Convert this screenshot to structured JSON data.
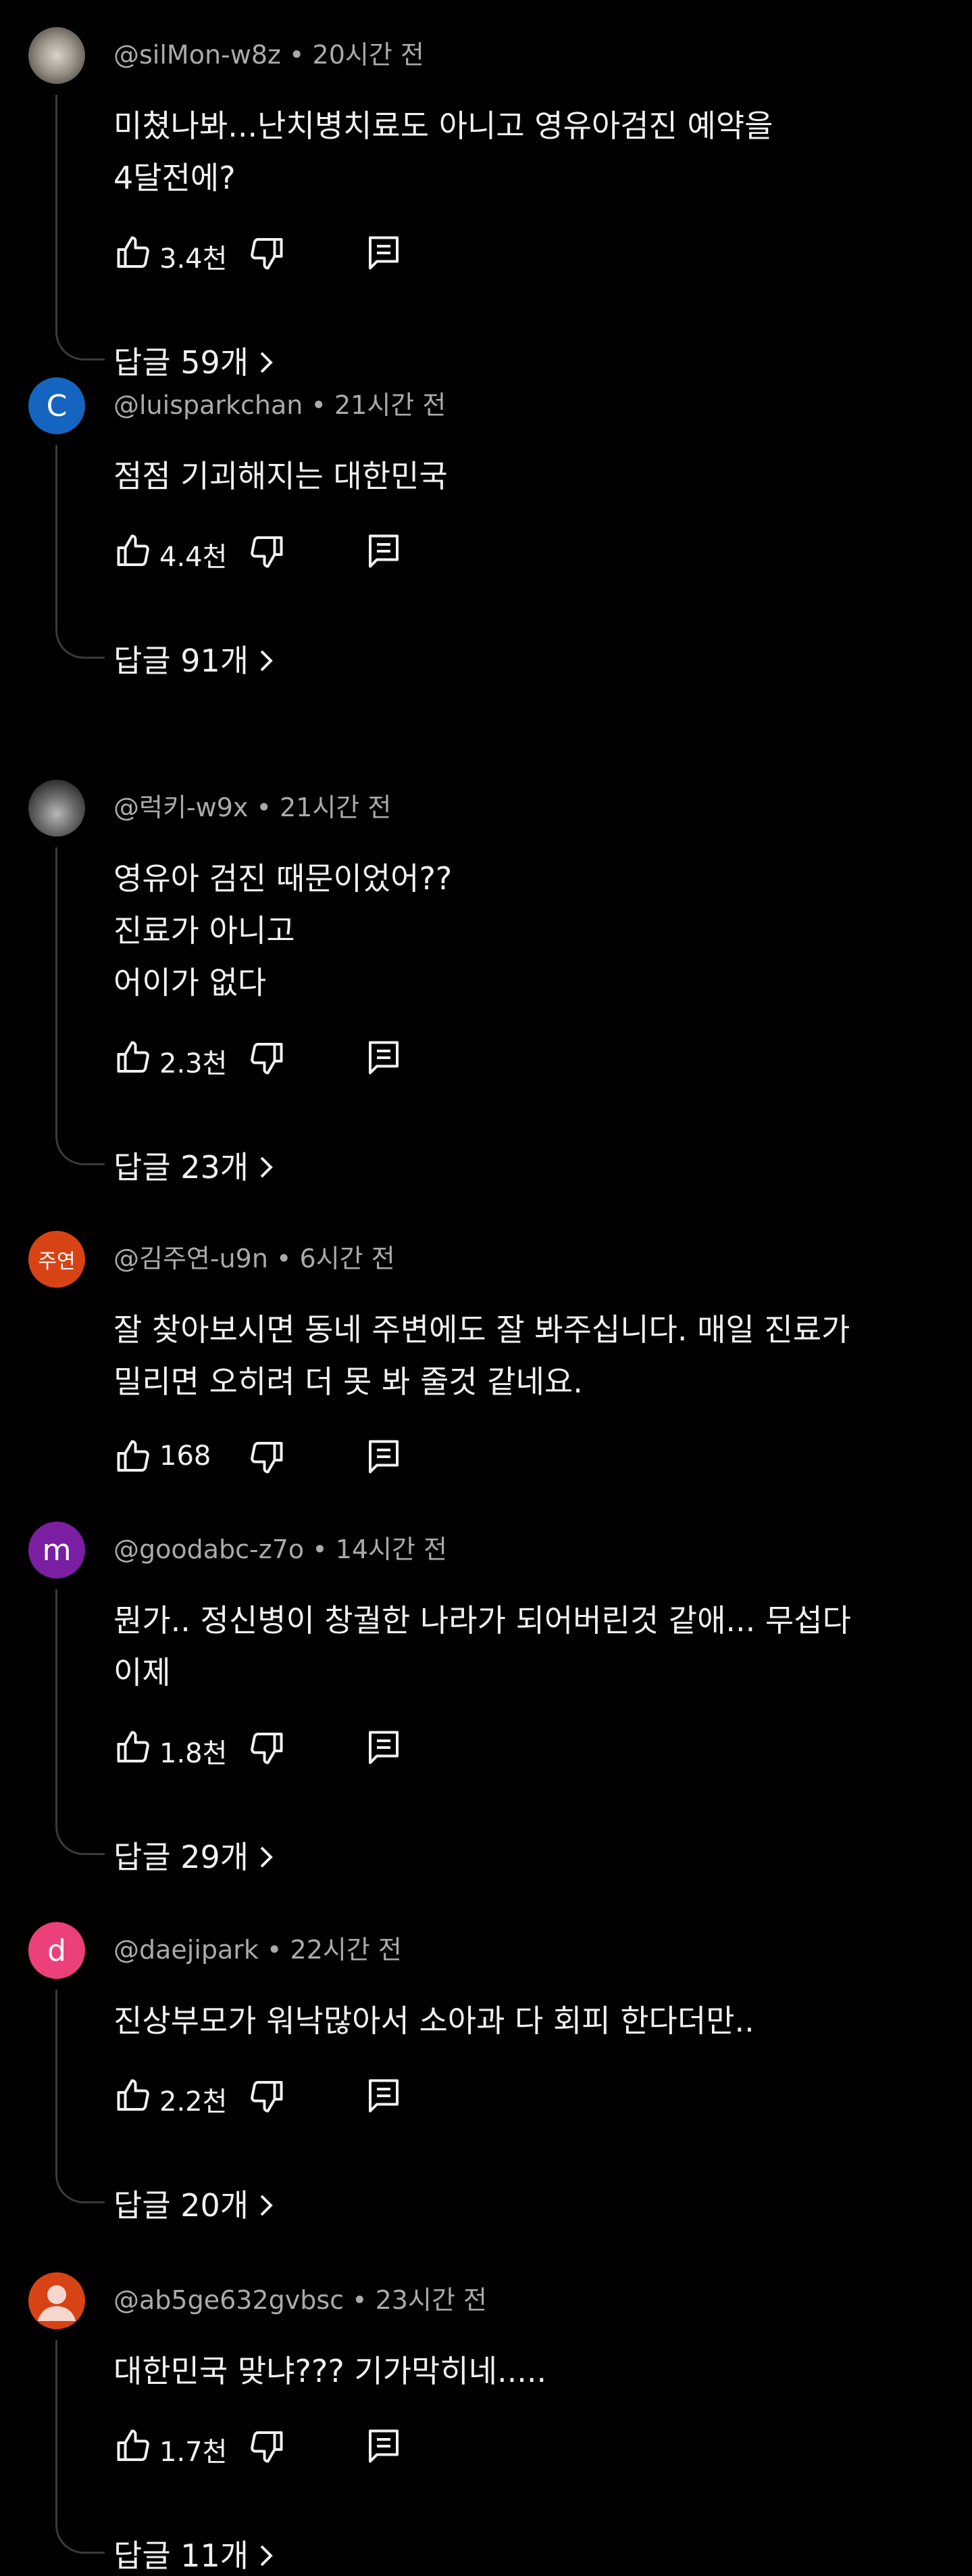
{
  "comments": [
    {
      "author": "@silMon-w8z",
      "time": "20시간 전",
      "avatar": {
        "kind": "photo",
        "style": "photo-a",
        "letter": ""
      },
      "lines": [
        "미쳤나봐...난치병치료도 아니고 영유아검진 예약을",
        "4달전에?"
      ],
      "likes": "3.4천",
      "replies": "답글 59개",
      "icons": {
        "like": "thumb-up-icon",
        "dislike": "thumb-down-icon",
        "reply": "reply-comment-icon"
      }
    },
    {
      "author": "@luisparkchan",
      "time": "21시간 전",
      "avatar": {
        "kind": "letter",
        "color": "#1565c0",
        "letter": "C"
      },
      "lines": [
        "점점 기괴해지는 대한민국"
      ],
      "likes": "4.4천",
      "replies": "답글 91개"
    },
    {
      "author": "@럭키-w9x",
      "time": "21시간 전",
      "avatar": {
        "kind": "photo",
        "style": "photo-b",
        "letter": ""
      },
      "lines": [
        "영유아 검진 때문이었어??",
        "진료가 아니고",
        "어이가 없다"
      ],
      "likes": "2.3천",
      "replies": "답글 23개"
    },
    {
      "author": "@김주연-u9n",
      "time": "6시간 전",
      "avatar": {
        "kind": "letter",
        "color": "#d84315",
        "letter": "주연"
      },
      "lines": [
        "잘 찾아보시면 동네 주변에도 잘 봐주십니다. 매일 진료가",
        "밀리면 오히려 더 못 봐 줄것 같네요."
      ],
      "likes": "168",
      "replies": ""
    },
    {
      "author": "@goodabc-z7o",
      "time": "14시간 전",
      "avatar": {
        "kind": "letter",
        "color": "#7b1fa2",
        "letter": "m"
      },
      "lines": [
        "뭔가.. 정신병이 창궐한 나라가 되어버린것 같애... 무섭다",
        "이제"
      ],
      "likes": "1.8천",
      "replies": "답글 29개"
    },
    {
      "author": "@daejipark",
      "time": "22시간 전",
      "avatar": {
        "kind": "letter",
        "color": "#ec407a",
        "letter": "d"
      },
      "lines": [
        "진상부모가 워낙많아서 소아과 다 회피 한다더만.."
      ],
      "likes": "2.2천",
      "replies": "답글 20개"
    },
    {
      "author": "@ab5ge632gvbsc",
      "time": "23시간 전",
      "avatar": {
        "kind": "default",
        "color": "#d84315",
        "letter": ""
      },
      "lines": [
        "대한민국 맞냐??? 기가막히네....."
      ],
      "likes": "1.7천",
      "replies": "답글 11개"
    }
  ],
  "separator": " • "
}
